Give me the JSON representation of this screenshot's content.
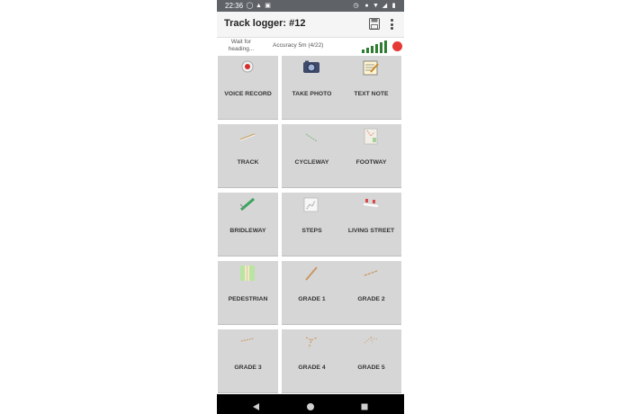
{
  "status_bar": {
    "time": "22:36",
    "left_icons": [
      "whatsapp-icon",
      "notification-icon",
      "gallery-icon"
    ],
    "right_icons": [
      "alarm-icon",
      "location-icon",
      "wifi-icon",
      "signal-icon",
      "battery-icon"
    ]
  },
  "app_bar": {
    "title": "Track logger: #12",
    "save_icon": "save-icon",
    "menu_icon": "more-vert-icon"
  },
  "info": {
    "heading_status": "Wait for heading...",
    "accuracy": "Accuracy 5m (4/22)",
    "signal_levels": 6,
    "colors": {
      "signal": "#2e7d32",
      "record": "#e53935"
    }
  },
  "buttons": [
    {
      "label": "VOICE RECORD",
      "icon": "voice-record-icon"
    },
    {
      "label": "TAKE PHOTO",
      "icon": "camera-icon"
    },
    {
      "label": "TEXT NOTE",
      "icon": "text-note-icon"
    },
    {
      "label": "TRACK",
      "icon": "track-icon"
    },
    {
      "label": "CYCLEWAY",
      "icon": "cycleway-icon"
    },
    {
      "label": "FOOTWAY",
      "icon": "footway-icon"
    },
    {
      "label": "BRIDLEWAY",
      "icon": "bridleway-icon"
    },
    {
      "label": "STEPS",
      "icon": "steps-icon"
    },
    {
      "label": "LIVING STREET",
      "icon": "living-street-icon"
    },
    {
      "label": "PEDESTRIAN",
      "icon": "pedestrian-icon"
    },
    {
      "label": "GRADE 1",
      "icon": "grade-1-icon"
    },
    {
      "label": "GRADE 2",
      "icon": "grade-2-icon"
    },
    {
      "label": "GRADE 3",
      "icon": "grade-3-icon"
    },
    {
      "label": "GRADE 4",
      "icon": "grade-4-icon"
    },
    {
      "label": "GRADE 5",
      "icon": "grade-5-icon"
    }
  ],
  "nav_bar": {
    "back_icon": "back-icon",
    "home_icon": "home-icon",
    "recents_icon": "recents-icon"
  },
  "colors": {
    "status_bar": "#5f6368",
    "app_bar": "#f5f5f5",
    "cell": "#d6d6d6",
    "nav_bar": "#000000"
  }
}
